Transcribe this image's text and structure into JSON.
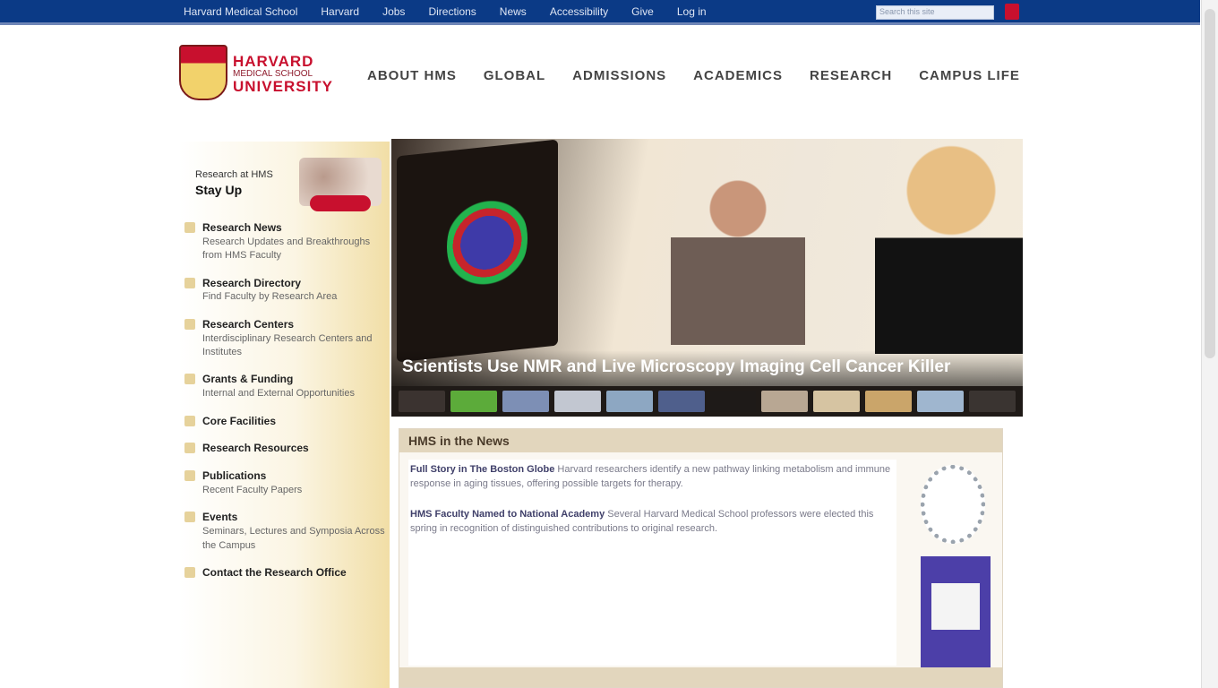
{
  "topbar": {
    "links": [
      "Harvard Medical School",
      "Harvard",
      "Jobs",
      "Directions",
      "News",
      "Accessibility",
      "Give",
      "Log in"
    ],
    "search_placeholder": "Search this site"
  },
  "logo": {
    "line1": "HARVARD",
    "line2": "MEDICAL SCHOOL",
    "line3": "UNIVERSITY"
  },
  "nav": {
    "items": [
      "ABOUT HMS",
      "GLOBAL",
      "ADMISSIONS",
      "ACADEMICS",
      "RESEARCH",
      "CAMPUS LIFE"
    ]
  },
  "sidebar": {
    "promo_small": "Research at HMS",
    "promo_title": "Stay Up",
    "items": [
      {
        "title": "Research News",
        "desc": "Research Updates and Breakthroughs from HMS Faculty"
      },
      {
        "title": "Research Directory",
        "desc": "Find Faculty by Research Area"
      },
      {
        "title": "Research Centers",
        "desc": "Interdisciplinary Research Centers and Institutes"
      },
      {
        "title": "Grants & Funding",
        "desc": "Internal and External Opportunities"
      },
      {
        "title": "Core Facilities",
        "desc": ""
      },
      {
        "title": "Research Resources",
        "desc": ""
      },
      {
        "title": "Publications",
        "desc": "Recent Faculty Papers"
      },
      {
        "title": "Events",
        "desc": "Seminars, Lectures and Symposia Across the Campus"
      },
      {
        "title": "Contact the Research Office",
        "desc": ""
      }
    ]
  },
  "hero": {
    "caption": "Scientists Use NMR and Live Microscopy Imaging Cell Cancer Killer",
    "thumb_colors": [
      "#3b3330",
      "#5cab3a",
      "#7d8fb5",
      "#c2c7d1",
      "#8da7c2",
      "#4f5f8c",
      "#1e1a18",
      "#b8a793",
      "#d6c4a2",
      "#caa56a",
      "#9fb6cf",
      "#3a3431"
    ]
  },
  "news": {
    "heading": "HMS in the News",
    "items": [
      {
        "lead": "Full Story in The Boston Globe",
        "text": "Harvard researchers identify a new pathway linking metabolism and immune response in aging tissues, offering possible targets for therapy."
      },
      {
        "lead": "HMS Faculty Named to National Academy",
        "text": "Several Harvard Medical School professors were elected this spring in recognition of distinguished contributions to original research."
      }
    ]
  }
}
